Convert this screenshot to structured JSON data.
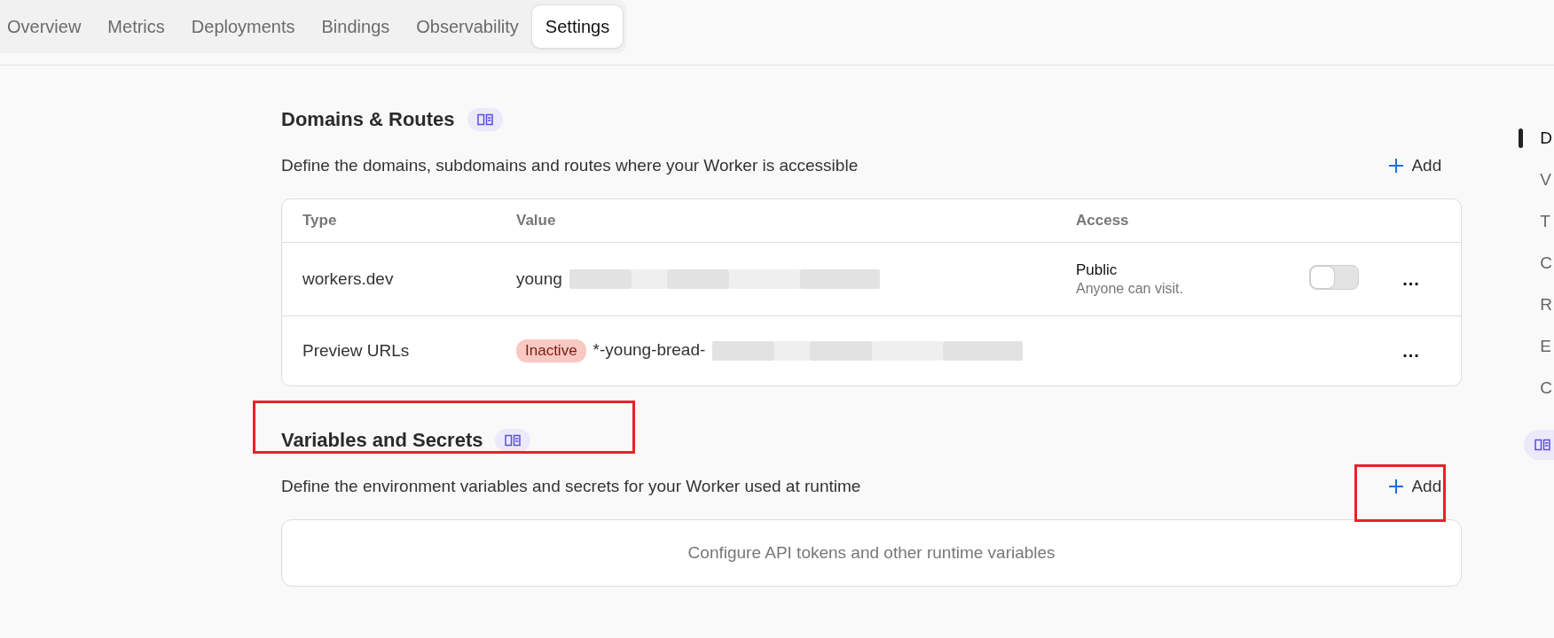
{
  "tabs": [
    {
      "label": "Overview",
      "selected": false
    },
    {
      "label": "Metrics",
      "selected": false
    },
    {
      "label": "Deployments",
      "selected": false
    },
    {
      "label": "Bindings",
      "selected": false
    },
    {
      "label": "Observability",
      "selected": false
    },
    {
      "label": "Settings",
      "selected": true
    }
  ],
  "sections": [
    {
      "title": "Domains & Routes",
      "description": "Define the domains, subdomains and routes where your Worker is accessible",
      "add_label": "Add",
      "title_highlighted": false,
      "add_highlighted": false,
      "kind": "table",
      "table": {
        "columns": [
          "Type",
          "Value",
          "Access"
        ],
        "rows": [
          {
            "type": "workers.dev",
            "value": "young",
            "access": "Public",
            "access_note": "Anyone can visit.",
            "toggle": {
              "on": false
            },
            "menu": "..."
          },
          {
            "type": "Preview URLs",
            "badge": "Inactive",
            "value": "*-young-bread-",
            "menu": "..."
          }
        ]
      }
    },
    {
      "title": "Variables and Secrets",
      "description": "Define the environment variables and secrets for your Worker used at runtime",
      "add_label": "Add",
      "title_highlighted": true,
      "add_highlighted": true,
      "kind": "empty",
      "empty_text": "Configure API tokens and other runtime variables"
    }
  ],
  "side_nav": [
    {
      "label": "D",
      "selected": true
    },
    {
      "label": "V",
      "selected": false
    },
    {
      "label": "T",
      "selected": false
    },
    {
      "label": "C",
      "selected": false
    },
    {
      "label": "R",
      "selected": false
    },
    {
      "label": "E",
      "selected": false
    },
    {
      "label": "C",
      "selected": false
    }
  ]
}
